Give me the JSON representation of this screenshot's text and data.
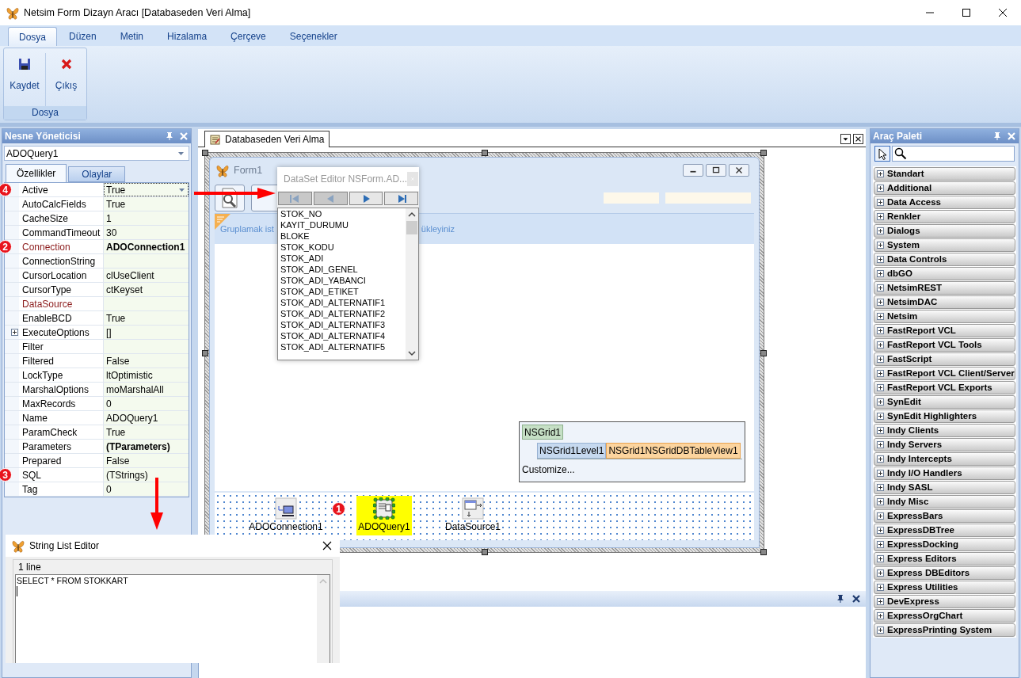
{
  "window": {
    "title": "Netsim Form Dizayn Aracı [Databaseden Veri Alma]"
  },
  "ribbon": {
    "tabs": [
      {
        "label": "Dosya",
        "selected": true
      },
      {
        "label": "Düzen",
        "selected": false
      },
      {
        "label": "Metin",
        "selected": false
      },
      {
        "label": "Hizalama",
        "selected": false
      },
      {
        "label": "Çerçeve",
        "selected": false
      },
      {
        "label": "Seçenekler",
        "selected": false
      }
    ],
    "groups": [
      {
        "label": "Dosya",
        "buttons": [
          {
            "label": "Kaydet",
            "kind": "save"
          },
          {
            "label": "Çıkış",
            "kind": "exit"
          }
        ]
      }
    ]
  },
  "object_inspector": {
    "title": "Nesne Yöneticisi",
    "object": "ADOQuery1",
    "tabs": [
      {
        "label": "Özellikler",
        "selected": true
      },
      {
        "label": "Olaylar",
        "selected": false
      }
    ],
    "properties": [
      {
        "name": "Active",
        "value": "True",
        "selected": true,
        "reference": false,
        "bold": false,
        "expandable": false,
        "callout": "4"
      },
      {
        "name": "AutoCalcFields",
        "value": "True",
        "selected": false,
        "reference": false,
        "bold": false,
        "expandable": false
      },
      {
        "name": "CacheSize",
        "value": "1",
        "selected": false,
        "reference": false,
        "bold": false,
        "expandable": false
      },
      {
        "name": "CommandTimeout",
        "value": "30",
        "selected": false,
        "reference": false,
        "bold": false,
        "expandable": false
      },
      {
        "name": "Connection",
        "value": "ADOConnection1",
        "selected": false,
        "reference": true,
        "bold": true,
        "expandable": false,
        "callout": "2"
      },
      {
        "name": "ConnectionString",
        "selected": false,
        "reference": false,
        "expandable": false
      },
      {
        "name": "CursorLocation",
        "value": "clUseClient",
        "selected": false,
        "reference": false,
        "bold": false,
        "expandable": false
      },
      {
        "name": "CursorType",
        "value": "ctKeyset",
        "selected": false,
        "reference": false,
        "bold": false,
        "expandable": false
      },
      {
        "name": "DataSource",
        "selected": false,
        "reference": true,
        "expandable": false
      },
      {
        "name": "EnableBCD",
        "value": "True",
        "selected": false,
        "reference": false,
        "bold": false,
        "expandable": false
      },
      {
        "name": "ExecuteOptions",
        "value": "[]",
        "selected": false,
        "reference": false,
        "bold": false,
        "expandable": true
      },
      {
        "name": "Filter",
        "selected": false,
        "reference": false,
        "expandable": false
      },
      {
        "name": "Filtered",
        "value": "False",
        "selected": false,
        "reference": false,
        "bold": false,
        "expandable": false
      },
      {
        "name": "LockType",
        "value": "ltOptimistic",
        "selected": false,
        "reference": false,
        "bold": false,
        "expandable": false
      },
      {
        "name": "MarshalOptions",
        "value": "moMarshalAll",
        "selected": false,
        "reference": false,
        "bold": false,
        "expandable": false
      },
      {
        "name": "MaxRecords",
        "value": "0",
        "selected": false,
        "reference": false,
        "bold": false,
        "expandable": false
      },
      {
        "name": "Name",
        "value": "ADOQuery1",
        "selected": false,
        "reference": false,
        "bold": false,
        "expandable": false
      },
      {
        "name": "ParamCheck",
        "value": "True",
        "selected": false,
        "reference": false,
        "bold": false,
        "expandable": false
      },
      {
        "name": "Parameters",
        "value": "(TParameters)",
        "selected": false,
        "reference": false,
        "bold": true,
        "expandable": false
      },
      {
        "name": "Prepared",
        "value": "False",
        "selected": false,
        "reference": false,
        "bold": false,
        "expandable": false
      },
      {
        "name": "SQL",
        "value": "(TStrings)",
        "selected": false,
        "reference": false,
        "bold": false,
        "expandable": false,
        "callout": "3"
      },
      {
        "name": "Tag",
        "value": "0",
        "selected": false,
        "reference": false,
        "bold": false,
        "expandable": false
      }
    ]
  },
  "designer": {
    "tab": "Databaseden Veri Alma",
    "form": {
      "title": "Form1",
      "group_hint_start": "Gruplamak ist",
      "group_hint_end": "ükleyiniz"
    },
    "grid_structure": {
      "root": "NSGrid1",
      "level": "NSGrid1Level1",
      "view": "NSGrid1NSGridDBTableView1",
      "action": "Customize..."
    },
    "components": [
      {
        "label": "ADOConnection1",
        "kind": "connection",
        "selected": false
      },
      {
        "label": "ADOQuery1",
        "kind": "query",
        "selected": true,
        "callout": "1"
      },
      {
        "label": "DataSource1",
        "kind": "datasource",
        "selected": false
      }
    ]
  },
  "dataset_editor": {
    "title": "DataSet Editor NSForm.AD...",
    "nav_buttons": [
      {
        "kind": "first",
        "disabled": true
      },
      {
        "kind": "prior",
        "disabled": true
      },
      {
        "kind": "next",
        "disabled": false
      },
      {
        "kind": "last",
        "disabled": false
      }
    ],
    "fields": [
      "STOK_NO",
      "KAYIT_DURUMU",
      "BLOKE",
      "STOK_KODU",
      "STOK_ADI",
      "STOK_ADI_GENEL",
      "STOK_ADI_YABANCI",
      "STOK_ADI_ETIKET",
      "STOK_ADI_ALTERNATIF1",
      "STOK_ADI_ALTERNATIF2",
      "STOK_ADI_ALTERNATIF3",
      "STOK_ADI_ALTERNATIF4",
      "STOK_ADI_ALTERNATIF5"
    ]
  },
  "string_list_editor": {
    "title": "String List Editor",
    "line_count": "1 line",
    "text": "SELECT * FROM STOKKART"
  },
  "tool_palette": {
    "title": "Araç Paleti",
    "categories": [
      "Standart",
      "Additional",
      "Data Access",
      "Renkler",
      "Dialogs",
      "System",
      "Data Controls",
      "dbGO",
      "NetsimREST",
      "NetsimDAC",
      "Netsim",
      "FastReport VCL",
      "FastReport VCL Tools",
      "FastScript",
      "FastReport VCL Client/Server",
      "FastReport VCL Exports",
      "SynEdit",
      "SynEdit Highlighters",
      "Indy Clients",
      "Indy Servers",
      "Indy Intercepts",
      "Indy I/O Handlers",
      "Indy SASL",
      "Indy Misc",
      "ExpressBars",
      "ExpressDBTree",
      "ExpressDocking",
      "Express Editors",
      "Express DBEditors",
      "Express Utilities",
      "DevExpress",
      "ExpressOrgChart",
      "ExpressPrinting System"
    ]
  }
}
